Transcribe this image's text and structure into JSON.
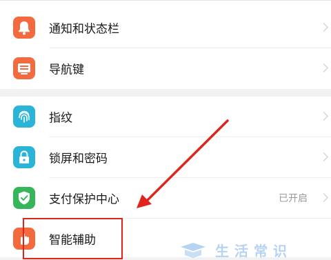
{
  "settings": {
    "items": [
      {
        "label": "通知和状态栏",
        "icon": "bell-icon",
        "color": "#f26a3d"
      },
      {
        "label": "导航键",
        "icon": "navigation-keys-icon",
        "color": "#f26a3d"
      },
      {
        "label": "指纹",
        "icon": "fingerprint-icon",
        "color": "#2ab4d8"
      },
      {
        "label": "锁屏和密码",
        "icon": "lock-icon",
        "color": "#2ab4d8"
      },
      {
        "label": "支付保护中心",
        "icon": "shield-check-icon",
        "color": "#36b65a",
        "value": "已开启"
      },
      {
        "label": "智能辅助",
        "icon": "hand-icon",
        "color": "#f26a3d"
      }
    ]
  },
  "annotation": {
    "color": "#e0241d"
  },
  "watermark": {
    "text": "生活常识"
  }
}
